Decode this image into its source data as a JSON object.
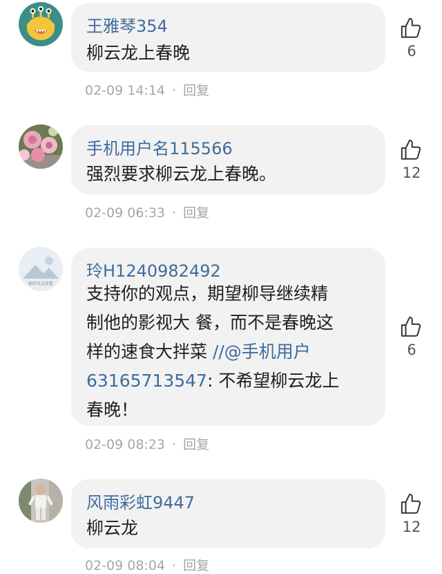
{
  "comments": [
    {
      "username": "王雅琴354",
      "text": "柳云龙上春晚",
      "date": "02-09 14:14",
      "reply_label": "回复",
      "likes": "6",
      "avatar_icon": "yellow-monster-avatar"
    },
    {
      "username": "手机用户名115566",
      "text": "强烈要求柳云龙上春晚。",
      "date": "02-09 06:33",
      "reply_label": "回复",
      "likes": "12",
      "avatar_icon": "pink-flowers-avatar"
    },
    {
      "username": "玲H1240982492",
      "text_lines": [
        "支持你的观点，期望柳导继续精",
        "制他的影视大 餐，而不是春晚这",
        "样的速食大拌菜 "
      ],
      "mention_part1": "//@手机用户",
      "mention_part2": "63165713547",
      "text_after_mention": ": 不希望柳云龙上",
      "text_last_line": "春晚！",
      "date": "02-09 08:23",
      "reply_label": "回复",
      "likes": "6",
      "avatar_icon": "mountain-placeholder-avatar",
      "avatar_caption": "翻转无法查看"
    },
    {
      "username": "风雨彩虹9447",
      "text": "柳云龙",
      "date": "02-09 08:04",
      "reply_label": "回复",
      "likes": "12",
      "avatar_icon": "person-photo-avatar"
    }
  ],
  "meta_separator": "·",
  "colors": {
    "username": "#3e6c9c",
    "bubble": "#f2f2f2",
    "meta": "#a6a6a6"
  }
}
